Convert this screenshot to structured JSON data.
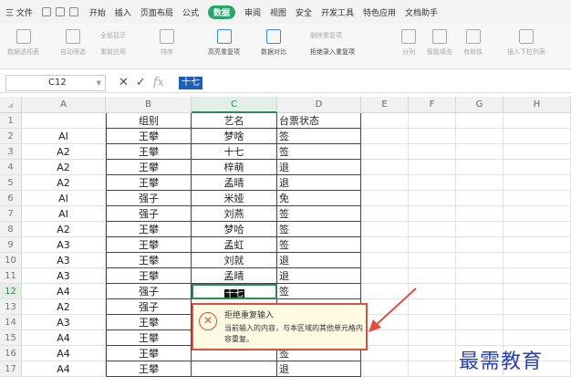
{
  "menu": {
    "hamburger": "三 文件",
    "tabs": [
      "开始",
      "插入",
      "页面布局",
      "公式",
      "数据",
      "审阅",
      "视图",
      "安全",
      "开发工具",
      "特色应用",
      "文档助手"
    ],
    "active_tab": "数据"
  },
  "ribbon": {
    "pivot": "数据透视表",
    "autofilter": "自动筛选",
    "show_all": "全部显示",
    "reapply": "重新应用",
    "sort": "排序",
    "highlight_dup": "高亮重复项",
    "compare": "数据对比",
    "remove_dup": "删除重复项",
    "reject_dup": "拒绝录入重复项",
    "split": "分列",
    "smart_fill": "智能填充",
    "validity": "有效性",
    "dropdown": "插入下拉列表"
  },
  "formula_bar": {
    "cell_ref": "C12",
    "fx": "fx",
    "value": "十七"
  },
  "columns": [
    "A",
    "B",
    "C",
    "D",
    "E",
    "F",
    "G",
    "H"
  ],
  "selected_column": "C",
  "selected_row": "12",
  "rows": [
    {
      "n": "1",
      "a": "",
      "b": "组别",
      "c": "艺名",
      "d": "台票状态"
    },
    {
      "n": "2",
      "a": "AI",
      "b": "王攀",
      "c": "梦啥",
      "d": "签"
    },
    {
      "n": "3",
      "a": "A2",
      "b": "王攀",
      "c": "十七",
      "d": "签"
    },
    {
      "n": "4",
      "a": "A2",
      "b": "王攀",
      "c": "梓萌",
      "d": "退"
    },
    {
      "n": "5",
      "a": "A2",
      "b": "王攀",
      "c": "孟晴",
      "d": "退"
    },
    {
      "n": "6",
      "a": "AI",
      "b": "强子",
      "c": "米娅",
      "d": "免"
    },
    {
      "n": "7",
      "a": "AI",
      "b": "强子",
      "c": "刘燕",
      "d": "签"
    },
    {
      "n": "8",
      "a": "A2",
      "b": "王攀",
      "c": "梦哈",
      "d": "签"
    },
    {
      "n": "9",
      "a": "A3",
      "b": "王攀",
      "c": "孟虹",
      "d": "签"
    },
    {
      "n": "10",
      "a": "A3",
      "b": "王攀",
      "c": "刘就",
      "d": "退"
    },
    {
      "n": "11",
      "a": "A3",
      "b": "王攀",
      "c": "孟晴",
      "d": "退"
    },
    {
      "n": "12",
      "a": "A4",
      "b": "强子",
      "c": "十七",
      "d": "签"
    },
    {
      "n": "13",
      "a": "A2",
      "b": "强子",
      "c": "",
      "d": ""
    },
    {
      "n": "14",
      "a": "A3",
      "b": "王攀",
      "c": "",
      "d": ""
    },
    {
      "n": "15",
      "a": "A4",
      "b": "王攀",
      "c": "",
      "d": ""
    },
    {
      "n": "16",
      "a": "A4",
      "b": "王攀",
      "c": "",
      "d": "签"
    },
    {
      "n": "17",
      "a": "A4",
      "b": "王攀",
      "c": "",
      "d": "退"
    }
  ],
  "popup": {
    "title": "拒绝重复输入",
    "message": "当前输入的内容，与本区域的其他单元格内容重复。"
  },
  "watermark": "最需教育",
  "colors": {
    "accent": "#2b8a4f",
    "error": "#e04f3d",
    "watermark": "#2a3fb0"
  }
}
